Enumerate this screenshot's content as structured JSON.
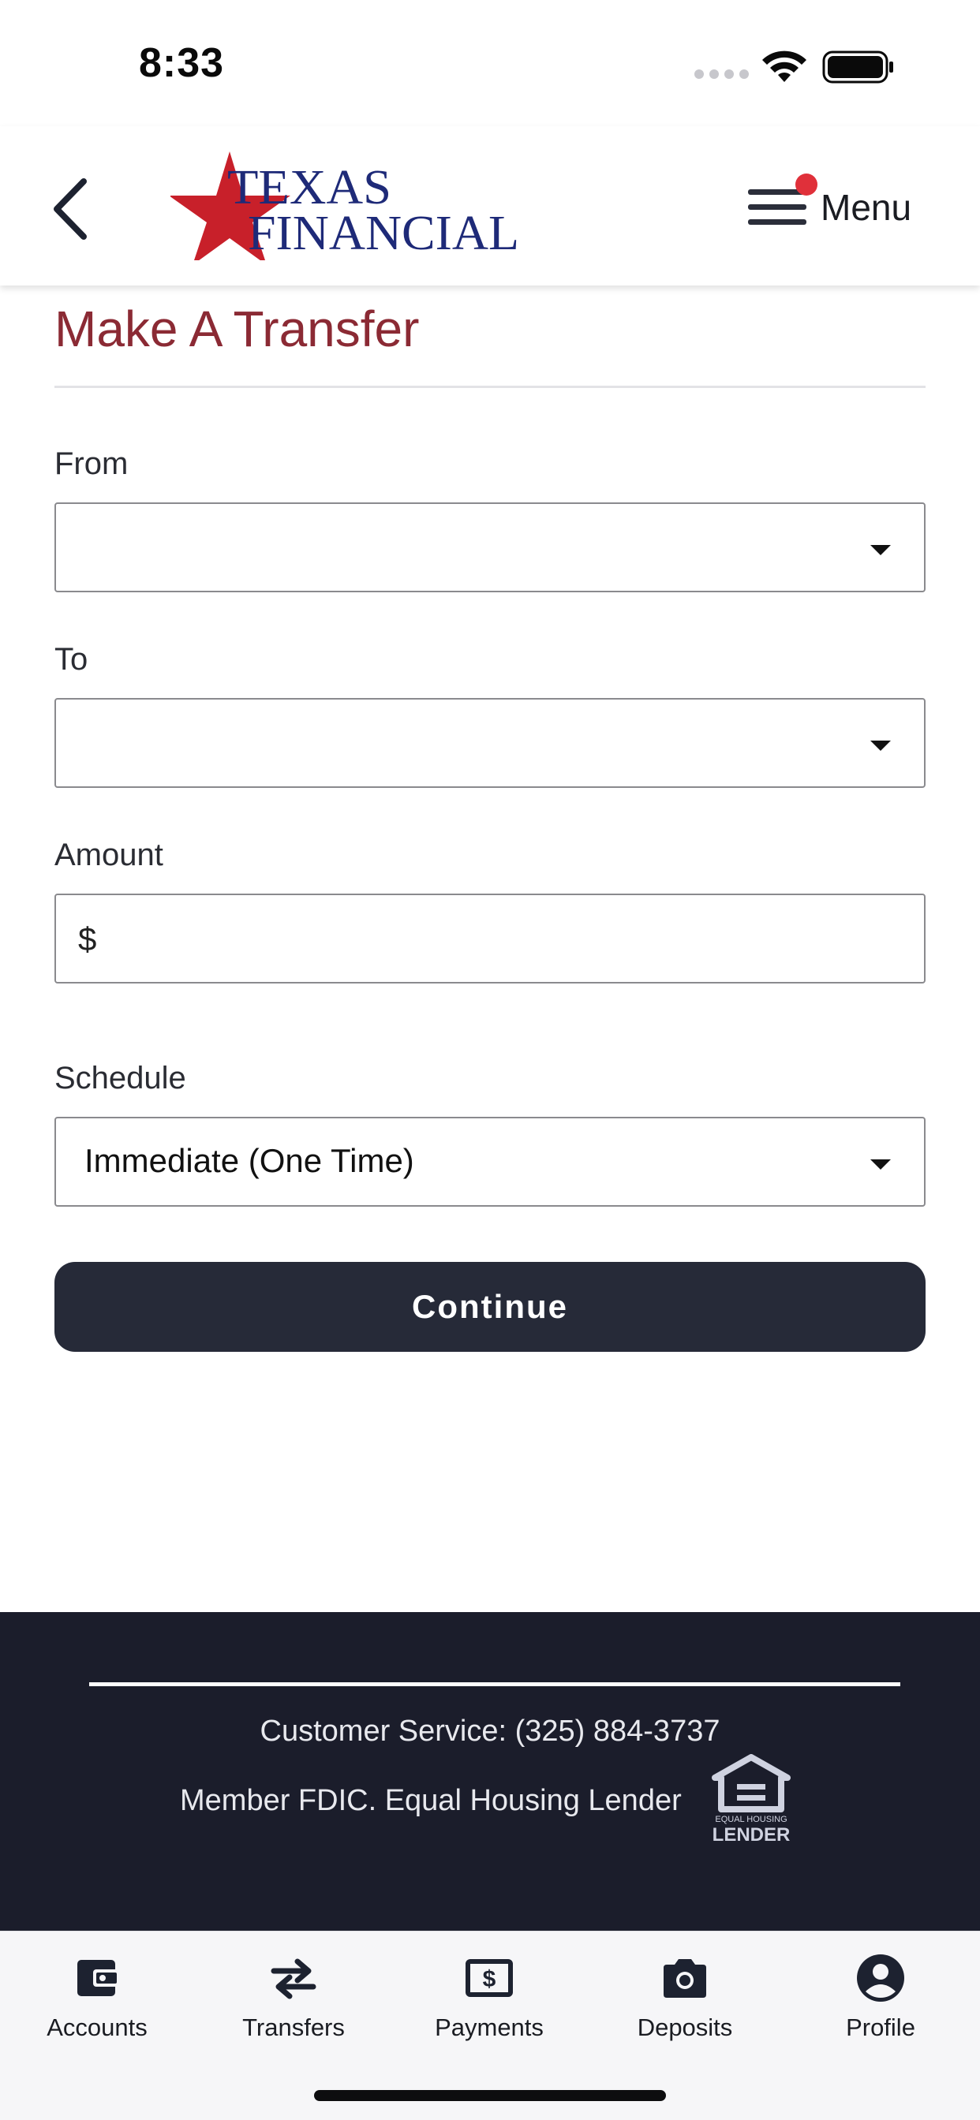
{
  "status_bar": {
    "time": "8:33"
  },
  "header": {
    "logo_text_line1": "TEXAS",
    "logo_text_line2": "FINANCIAL",
    "menu_label": "Menu"
  },
  "page": {
    "title": "Make A Transfer"
  },
  "form": {
    "from_label": "From",
    "from_value": "",
    "to_label": "To",
    "to_value": "",
    "amount_label": "Amount",
    "amount_prefix": "$",
    "amount_value": "",
    "schedule_label": "Schedule",
    "schedule_value": "Immediate (One Time)",
    "continue_label": "Continue"
  },
  "footer": {
    "customer_service": "Customer Service: (325) 884-3737",
    "member_text": "Member FDIC. Equal Housing Lender",
    "ehl_line1": "EQUAL HOUSING",
    "ehl_line2": "LENDER"
  },
  "tabs": [
    {
      "label": "Accounts",
      "icon": "wallet-icon"
    },
    {
      "label": "Transfers",
      "icon": "transfer-arrows-icon"
    },
    {
      "label": "Payments",
      "icon": "dollar-bill-icon"
    },
    {
      "label": "Deposits",
      "icon": "camera-icon"
    },
    {
      "label": "Profile",
      "icon": "account-circle-icon"
    }
  ],
  "colors": {
    "title": "#8b2a34",
    "button": "#262a38",
    "footer_bg": "#1b1d2b",
    "notification_dot": "#e0303a",
    "logo_star": "#c8202a",
    "logo_text": "#1e2a78"
  }
}
